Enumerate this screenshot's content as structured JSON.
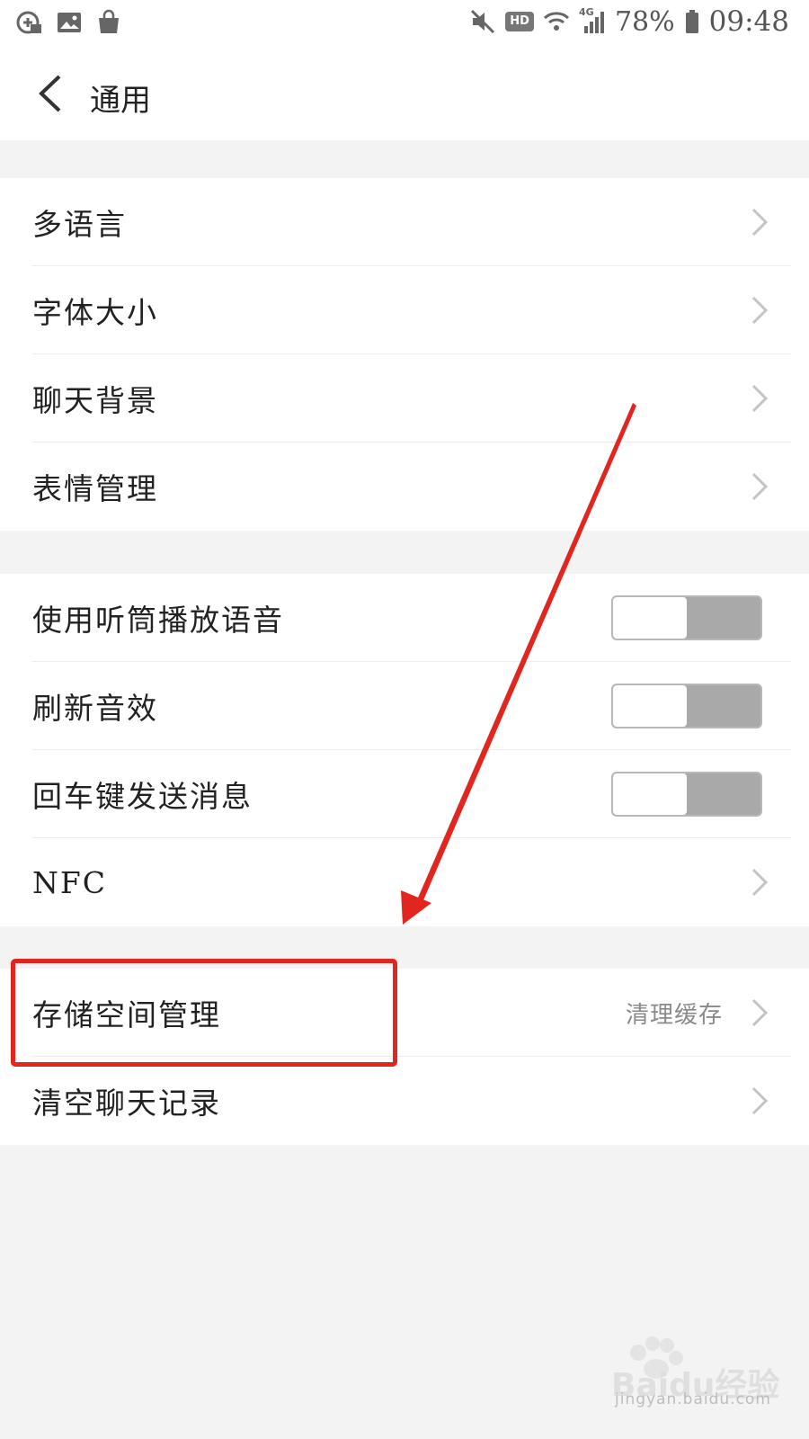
{
  "status_bar": {
    "left_icons": [
      "app-notification-icon",
      "image-icon",
      "shopping-bag-icon"
    ],
    "right_icons": [
      "mute-icon",
      "wifi-icon",
      "signal-4g-icon",
      "battery-icon"
    ],
    "hd_badge": "HD",
    "network_label": "4G",
    "battery": "78%",
    "time": "09:48"
  },
  "header": {
    "title": "通用",
    "back_icon": "chevron-left-icon"
  },
  "group1": {
    "items": [
      {
        "label": "多语言"
      },
      {
        "label": "字体大小"
      },
      {
        "label": "聊天背景"
      },
      {
        "label": "表情管理"
      }
    ]
  },
  "group2": {
    "items": [
      {
        "label": "使用听筒播放语音",
        "toggle_on": false
      },
      {
        "label": "刷新音效",
        "toggle_on": false
      },
      {
        "label": "回车键发送消息",
        "toggle_on": false
      },
      {
        "label": "NFC"
      }
    ]
  },
  "group3": {
    "items": [
      {
        "label": "存储空间管理",
        "value": "清理缓存"
      },
      {
        "label": "清空聊天记录"
      }
    ]
  },
  "annotation": {
    "highlight_color": "#e0261f",
    "arrow_color": "#e0261f"
  },
  "watermark": {
    "brand": "Baidu经验",
    "domain": "jingyan.baidu.com"
  },
  "colors": {
    "background": "#f3f3f3",
    "surface": "#ffffff",
    "toggle_off": "#a9a9a9",
    "secondary_text": "#8a8a8a"
  }
}
